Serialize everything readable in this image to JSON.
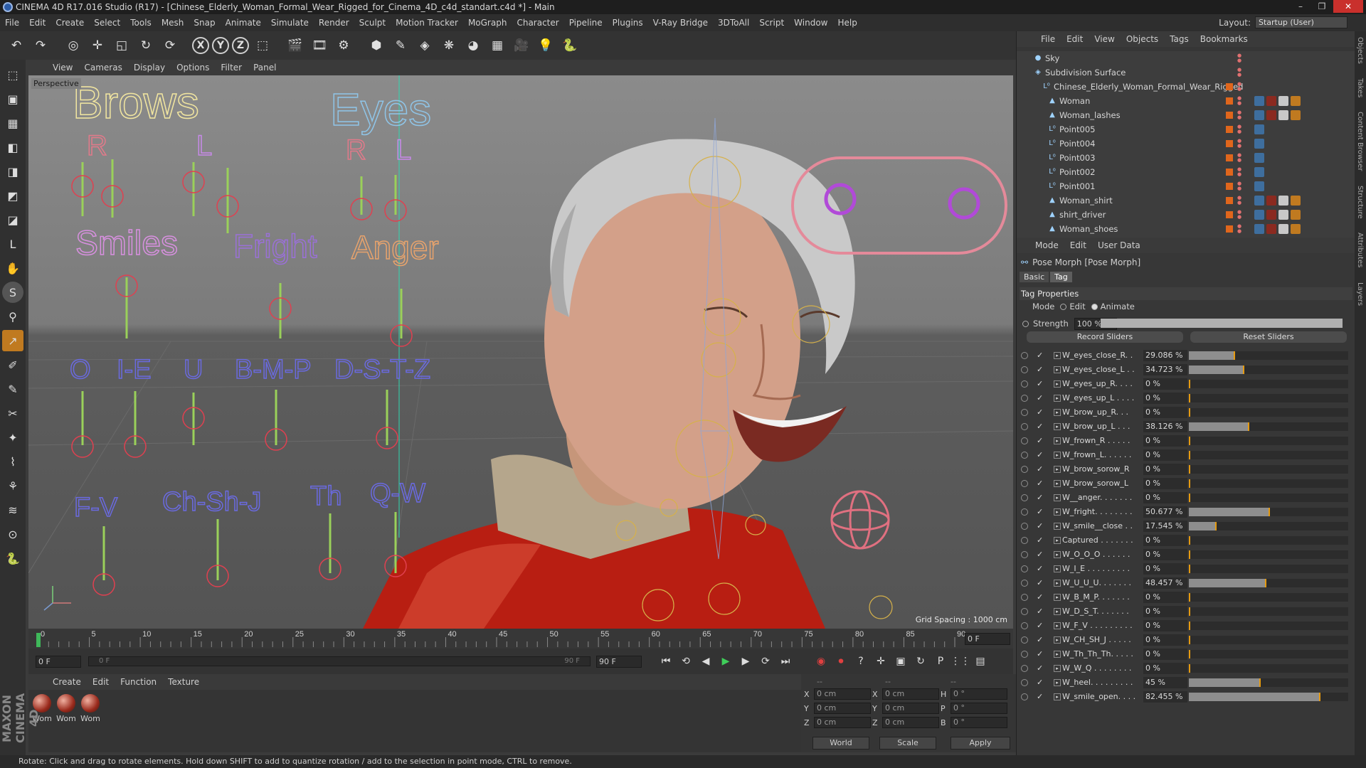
{
  "window": {
    "title": "CINEMA 4D R17.016 Studio (R17) - [Chinese_Elderly_Woman_Formal_Wear_Rigged_for_Cinema_4D_c4d_standart.c4d *] - Main",
    "buttons": [
      "–",
      "❐",
      "✕"
    ]
  },
  "menubar": {
    "items": [
      "File",
      "Edit",
      "Create",
      "Select",
      "Tools",
      "Mesh",
      "Snap",
      "Animate",
      "Simulate",
      "Render",
      "Sculpt",
      "Motion Tracker",
      "MoGraph",
      "Character",
      "Pipeline",
      "Plugins",
      "V-Ray Bridge",
      "3DToAll",
      "Script",
      "Window",
      "Help"
    ],
    "layout_label": "Layout:",
    "layout_value": "Startup (User)"
  },
  "toolbar": {
    "icons": [
      "undo-icon",
      "redo-icon",
      "live-select-icon",
      "move-icon",
      "scale-icon",
      "rotate-icon",
      "recent-tool-icon",
      "x-axis-icon",
      "y-axis-icon",
      "z-axis-icon",
      "coordinate-system-icon",
      "render-view-icon",
      "render-picture-viewer-icon",
      "render-settings-icon",
      "cube-icon",
      "pen-spline-icon",
      "subdivision-icon",
      "array-icon",
      "deformer-icon",
      "floor-icon",
      "camera-icon",
      "light-icon",
      "python-icon"
    ],
    "glyphs": [
      "↶",
      "↷",
      "◎",
      "✛",
      "◱",
      "↻",
      "⟳",
      "X",
      "Y",
      "Z",
      "⬚",
      "🎬",
      "🎞",
      "⚙",
      "⬢",
      "✎",
      "◈",
      "❋",
      "◕",
      "▦",
      "🎥",
      "💡",
      "🐍"
    ]
  },
  "left_tools": {
    "glyphs": [
      "⬚",
      "▣",
      "▦",
      "◧",
      "◨",
      "◩",
      "◪",
      "L",
      "✋",
      "S",
      "⚲",
      "↗",
      "✐",
      "✎",
      "✂",
      "✦",
      "⌇",
      "⚘",
      "≋",
      "⊙",
      "🐍"
    ]
  },
  "viewport": {
    "menu": [
      "View",
      "Cameras",
      "Display",
      "Options",
      "Filter",
      "Panel"
    ],
    "label": "Perspective",
    "grid_spacing": "Grid Spacing : 1000 cm",
    "rig_labels": {
      "brows": "Brows",
      "eyes": "Eyes",
      "r": "R",
      "l": "L",
      "smiles": "Smiles",
      "fright": "Fright",
      "anger": "Anger",
      "o": "O",
      "ie": "I-E",
      "u": "U",
      "bmp": "B-M-P",
      "dstz": "D-S-T-Z",
      "fv": "F-V",
      "chshj": "Ch-Sh-J",
      "th": "Th",
      "qw": "Q-W"
    },
    "colors": {
      "brows": "#f2e6a0",
      "eyes": "#8fc5e8",
      "r": "#e27a8a",
      "l": "#c78ae8",
      "smiles": "#d890e0",
      "fright": "#9a70d8",
      "anger": "#e8a36c",
      "phonemes": "#6a6ae0",
      "rig_green": "#9ad05a",
      "rig_red": "#e04050"
    }
  },
  "timeline": {
    "ticks": [
      "0",
      "5",
      "10",
      "15",
      "20",
      "25",
      "30",
      "35",
      "40",
      "45",
      "50",
      "55",
      "60",
      "65",
      "70",
      "75",
      "80",
      "85",
      "90"
    ],
    "current_frame": "0 F",
    "start_field": "0 F",
    "range_start": "0 F",
    "range_end": "90 F",
    "end_field": "90 F"
  },
  "transport": {
    "glyphs": [
      "⏮",
      "⟲",
      "◀",
      "▶",
      "▶",
      "⟳",
      "⏭",
      "◉",
      "⏺",
      "?",
      "✛",
      "▣",
      "↻",
      "P",
      "⋮⋮",
      "▤"
    ]
  },
  "materials": {
    "menu": [
      "Create",
      "Edit",
      "Function",
      "Texture"
    ],
    "items": [
      "Wom",
      "Wom",
      "Wom"
    ]
  },
  "coords": {
    "header": [
      "--",
      "--",
      "--"
    ],
    "rows": [
      {
        "a": "X",
        "av": "0 cm",
        "b": "X",
        "bv": "0 cm",
        "c": "H",
        "cv": "0 °"
      },
      {
        "a": "Y",
        "av": "0 cm",
        "b": "Y",
        "bv": "0 cm",
        "c": "P",
        "cv": "0 °"
      },
      {
        "a": "Z",
        "av": "0 cm",
        "b": "Z",
        "bv": "0 cm",
        "c": "B",
        "cv": "0 °"
      }
    ],
    "world": "World",
    "scale": "Scale",
    "apply": "Apply"
  },
  "maxon": "MAXON CINEMA 4D",
  "status": "Rotate: Click and drag to rotate elements. Hold down SHIFT to add to quantize rotation / add to the selection in point mode, CTRL to remove.",
  "object_manager": {
    "menu": [
      "File",
      "Edit",
      "View",
      "Objects",
      "Tags",
      "Bookmarks"
    ],
    "rows": [
      {
        "name": "Sky",
        "icon": "sky-icon",
        "glyph": "●"
      },
      {
        "name": "Subdivision Surface",
        "icon": "subdivision-icon",
        "glyph": "◈"
      },
      {
        "name": "Chinese_Elderly_Woman_Formal_Wear_Rigged",
        "icon": "null-icon",
        "glyph": "L⁰"
      },
      {
        "name": "Woman",
        "icon": "polygon-icon",
        "glyph": "▲"
      },
      {
        "name": "Woman_lashes",
        "icon": "polygon-icon",
        "glyph": "▲"
      },
      {
        "name": "Point005",
        "icon": "null-icon",
        "glyph": "L⁰"
      },
      {
        "name": "Point004",
        "icon": "null-icon",
        "glyph": "L⁰"
      },
      {
        "name": "Point003",
        "icon": "null-icon",
        "glyph": "L⁰"
      },
      {
        "name": "Point002",
        "icon": "null-icon",
        "glyph": "L⁰"
      },
      {
        "name": "Point001",
        "icon": "null-icon",
        "glyph": "L⁰"
      },
      {
        "name": "Woman_shirt",
        "icon": "polygon-icon",
        "glyph": "▲"
      },
      {
        "name": "shirt_driver",
        "icon": "polygon-icon",
        "glyph": "▲"
      },
      {
        "name": "Woman_shoes",
        "icon": "polygon-icon",
        "glyph": "▲"
      }
    ]
  },
  "right_strip": [
    "Objects",
    "Takes",
    "Content Browser",
    "Structure",
    "Attributes",
    "Layers"
  ],
  "attributes": {
    "menu": [
      "Mode",
      "Edit",
      "User Data"
    ],
    "title": "Pose Morph [Pose Morph]",
    "tabs": [
      "Basic",
      "Tag"
    ],
    "section": "Tag Properties",
    "mode_label": "Mode",
    "mode_edit": "Edit",
    "mode_animate": "Animate",
    "strength_label": "Strength",
    "strength_value": "100 %",
    "strength": 1.0,
    "record": "Record Sliders",
    "reset": "Reset Sliders",
    "sliders": [
      {
        "name": "W_eyes_close_R. .",
        "value": "29.086 %",
        "level": 0.29086
      },
      {
        "name": "W_eyes_close_L . .",
        "value": "34.723 %",
        "level": 0.34723
      },
      {
        "name": "W_eyes_up_R. . . .",
        "value": "0 %",
        "level": 0
      },
      {
        "name": "W_eyes_up_L . . . .",
        "value": "0 %",
        "level": 0
      },
      {
        "name": "W_brow_up_R. . .",
        "value": "0 %",
        "level": 0
      },
      {
        "name": "W_brow_up_L . . .",
        "value": "38.126 %",
        "level": 0.38126
      },
      {
        "name": "W_frown_R . . . . .",
        "value": "0 %",
        "level": 0
      },
      {
        "name": "W_frown_L. . . . . .",
        "value": "0 %",
        "level": 0
      },
      {
        "name": "W_brow_sorow_R",
        "value": "0 %",
        "level": 0
      },
      {
        "name": "W_brow_sorow_L",
        "value": "0 %",
        "level": 0
      },
      {
        "name": "W__anger. . . . . . .",
        "value": "0 %",
        "level": 0
      },
      {
        "name": "W_fright. . . . . . . .",
        "value": "50.677 %",
        "level": 0.50677
      },
      {
        "name": "W_smile__close . .",
        "value": "17.545 %",
        "level": 0.17545
      },
      {
        "name": "Captured . . . . . . .",
        "value": "0 %",
        "level": 0
      },
      {
        "name": "W_O_O_O . . . . . .",
        "value": "0 %",
        "level": 0
      },
      {
        "name": "W_I_E . . . . . . . . .",
        "value": "0 %",
        "level": 0
      },
      {
        "name": "W_U_U_U. . . . . . .",
        "value": "48.457 %",
        "level": 0.48457
      },
      {
        "name": "W_B_M_P. . . . . . .",
        "value": "0 %",
        "level": 0
      },
      {
        "name": "W_D_S_T. . . . . . .",
        "value": "0 %",
        "level": 0
      },
      {
        "name": "W_F_V . . . . . . . . .",
        "value": "0 %",
        "level": 0
      },
      {
        "name": "W_CH_SH_J . . . . .",
        "value": "0 %",
        "level": 0
      },
      {
        "name": "W_Th_Th_Th. . . . .",
        "value": "0 %",
        "level": 0
      },
      {
        "name": "W_W_Q . . . . . . . .",
        "value": "0 %",
        "level": 0
      },
      {
        "name": "W_heel. . . . . . . . .",
        "value": "45 %",
        "level": 0.45
      },
      {
        "name": "W_smile_open. . . .",
        "value": "82.455 %",
        "level": 0.82455
      }
    ]
  }
}
